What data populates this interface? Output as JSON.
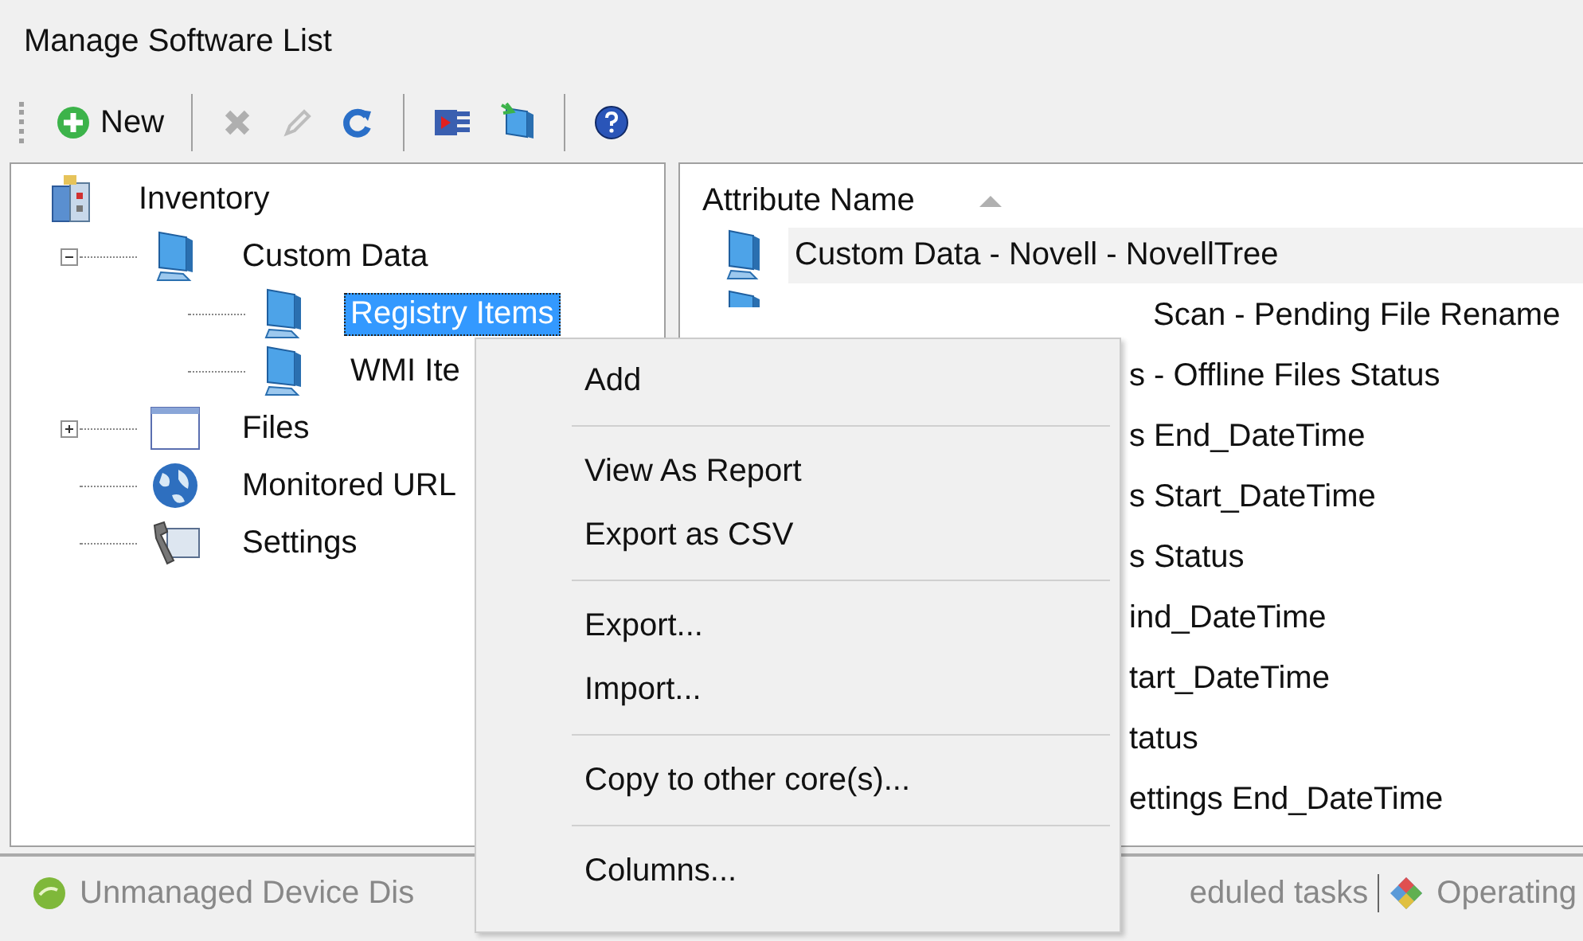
{
  "window": {
    "title": "Manage Software List"
  },
  "toolbar": {
    "groups": [
      [
        {
          "kind": "add",
          "label": "New",
          "disabled": false
        }
      ],
      [
        {
          "kind": "delete",
          "disabled": true
        },
        {
          "kind": "edit",
          "disabled": true
        },
        {
          "kind": "refresh",
          "disabled": false
        }
      ],
      [
        {
          "kind": "report",
          "disabled": false
        },
        {
          "kind": "export",
          "disabled": false
        }
      ],
      [
        {
          "kind": "help",
          "disabled": false
        }
      ]
    ]
  },
  "tree": [
    {
      "label": "Inventory",
      "kind": "inventory",
      "selected": false,
      "children": [
        {
          "label": "Custom Data",
          "kind": "monitor",
          "expanded": true,
          "selected": false,
          "children": [
            {
              "label": "Registry Items",
              "kind": "monitor",
              "selected": true
            },
            {
              "label": "WMI Ite",
              "kind": "monitor",
              "selected": false
            }
          ]
        },
        {
          "label": "Files",
          "kind": "window",
          "expanded": false,
          "selected": false
        },
        {
          "label": "Monitored URL",
          "kind": "globe",
          "selected": false
        },
        {
          "label": "Settings",
          "kind": "wrench",
          "selected": false
        }
      ]
    }
  ],
  "list": {
    "column": "Attribute Name",
    "rows": [
      {
        "text": "Custom Data - Novell - NovellTree",
        "icon": true,
        "selected": true,
        "covered": false
      },
      {
        "text": "Scan - Pending File Rename",
        "icon": true,
        "selected": false,
        "covered": true
      },
      {
        "text": "s - Offline Files Status",
        "icon": false,
        "selected": false,
        "covered": true
      },
      {
        "text": "s End_DateTime",
        "icon": false,
        "selected": false,
        "covered": true
      },
      {
        "text": "s Start_DateTime",
        "icon": false,
        "selected": false,
        "covered": true
      },
      {
        "text": "s Status",
        "icon": false,
        "selected": false,
        "covered": true
      },
      {
        "text": "ind_DateTime",
        "icon": false,
        "selected": false,
        "covered": true
      },
      {
        "text": "tart_DateTime",
        "icon": false,
        "selected": false,
        "covered": true
      },
      {
        "text": "tatus",
        "icon": false,
        "selected": false,
        "covered": true
      },
      {
        "text": "ettings End_DateTime",
        "icon": false,
        "selected": false,
        "covered": true
      }
    ]
  },
  "status_bar": {
    "left": {
      "label": "Unmanaged Device Dis",
      "kind": "disc"
    },
    "right": [
      {
        "label": "eduled tasks",
        "kind": "none"
      },
      {
        "label": "Operating",
        "kind": "diamond"
      }
    ]
  },
  "context_menu": [
    [
      "Add"
    ],
    [
      "View As Report",
      "Export as CSV"
    ],
    [
      "Export...",
      "Import..."
    ],
    [
      "Copy to other core(s)..."
    ],
    [
      "Columns..."
    ]
  ]
}
